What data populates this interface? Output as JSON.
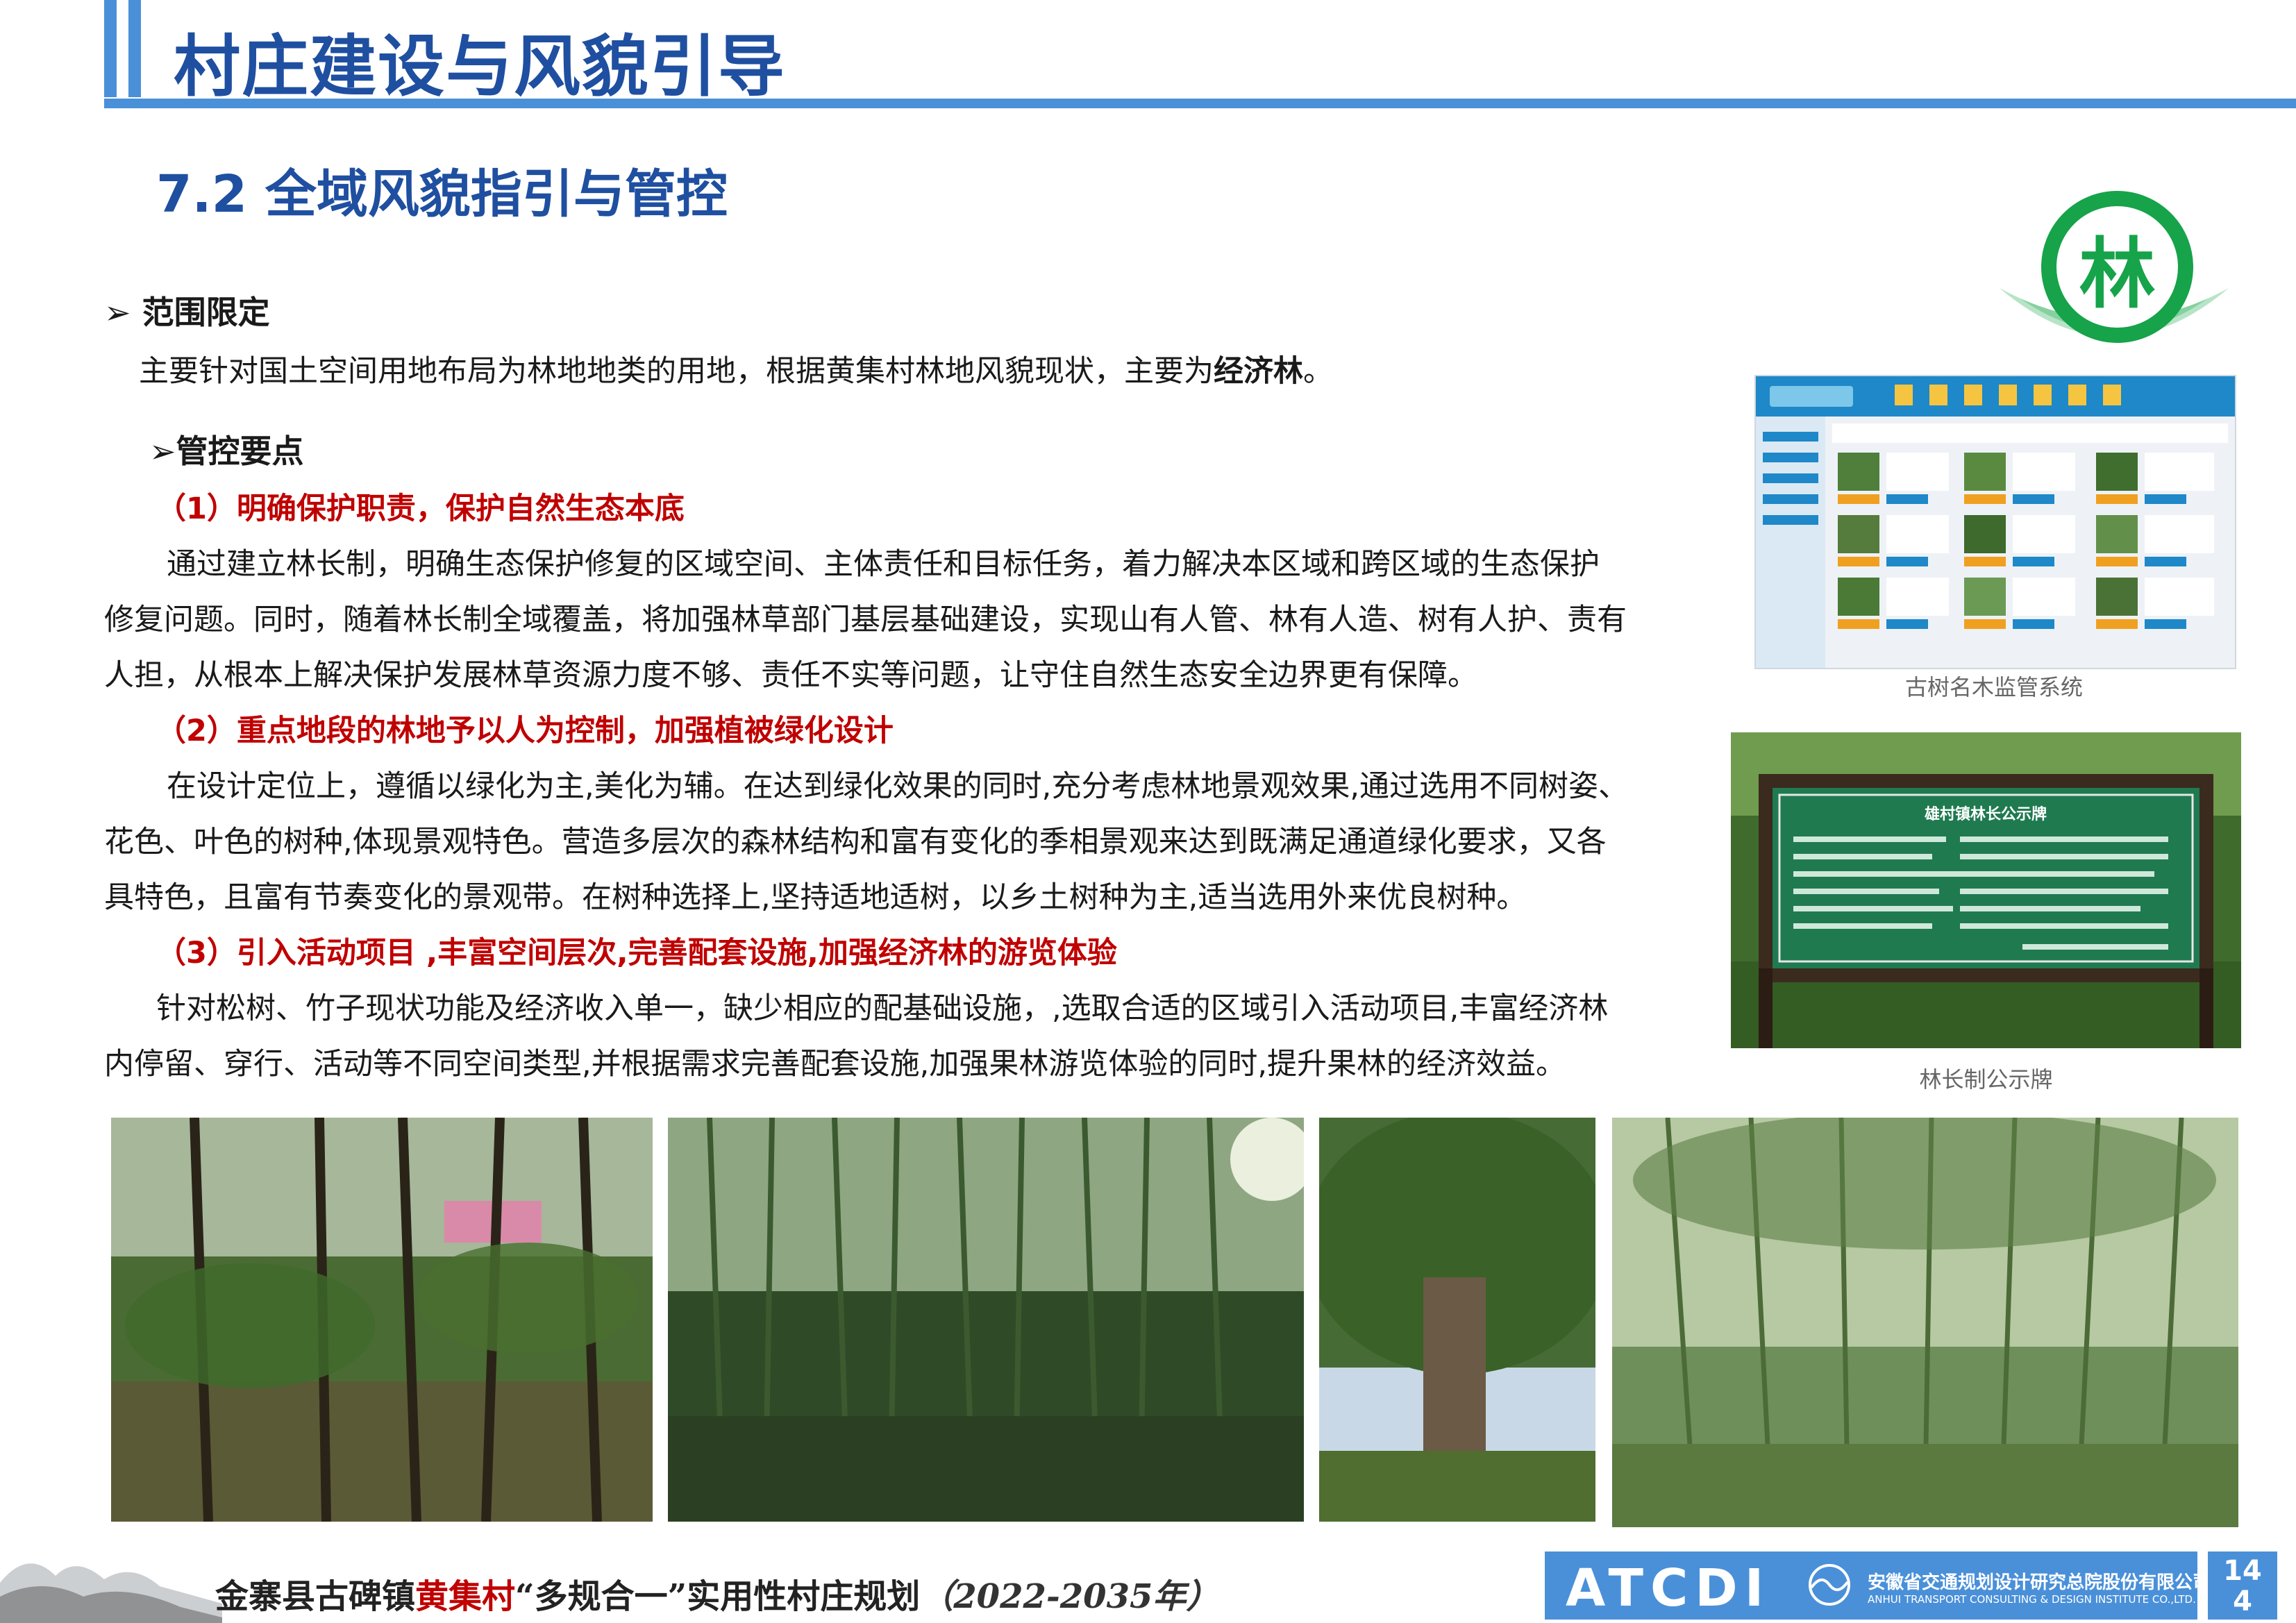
{
  "header": {
    "title": "村庄建设与风貌引导",
    "section": "7.2 全域风貌指引与管控"
  },
  "badge": {
    "char": "林"
  },
  "scope": {
    "heading": "范围限定",
    "text_prefix": "主要针对国土空间用地布局为林地地类的用地，根据黄集村林地风貌现状，主要为",
    "text_bold": "经济林",
    "text_suffix": "。"
  },
  "control": {
    "heading": "管控要点",
    "points": [
      {
        "title": "（1）明确保护职责，保护自然生态本底",
        "lines": [
          "通过建立林长制，明确生态保护修复的区域空间、主体责任和目标任务，着力解决本区域和跨区域的生态保护",
          "修复问题。同时，随着林长制全域覆盖，将加强林草部门基层基础建设，实现山有人管、林有人造、树有人护、责有",
          "人担，从根本上解决保护发展林草资源力度不够、责任不实等问题，让守住自然生态安全边界更有保障。"
        ]
      },
      {
        "title": "（2）重点地段的林地予以人为控制，加强植被绿化设计",
        "lines": [
          "在设计定位上，遵循以绿化为主,美化为辅。在达到绿化效果的同时,充分考虑林地景观效果,通过选用不同树姿、",
          "花色、叶色的树种,体现景观特色。营造多层次的森林结构和富有变化的季相景观来达到既满足通道绿化要求，又各",
          "具特色，且富有节奏变化的景观带。在树种选择上,坚持适地适树，以乡土树种为主,适当选用外来优良树种。"
        ]
      },
      {
        "title": "（3）引入活动项目 ,丰富空间层次,完善配套设施,加强经济林的游览体验",
        "lines": [
          "针对松树、竹子现状功能及经济收入单一，缺少相应的配基础设施，,选取合适的区域引入活动项目,丰富经济林",
          "内停留、穿行、活动等不同空间类型,并根据需求完善配套设施,加强果林游览体验的同时,提升果林的经济效益。"
        ]
      }
    ]
  },
  "images": {
    "system_caption": "古树名木监管系统",
    "board_caption": "林长制公示牌",
    "board_title": "雄村镇林长公示牌"
  },
  "footer": {
    "county": "金寨县古碑镇",
    "village": "黄集村",
    "plan": "“多规合一”实用性村庄规划",
    "years": "（2022-2035年）",
    "logo": "ATCDI",
    "company_cn": "安徽省交通规划设计研究总院股份有限公司",
    "company_en": "ANHUI TRANSPORT CONSULTING & DESIGN INSTITUTE CO.,LTD.",
    "page_a": "14",
    "page_b": "4"
  }
}
